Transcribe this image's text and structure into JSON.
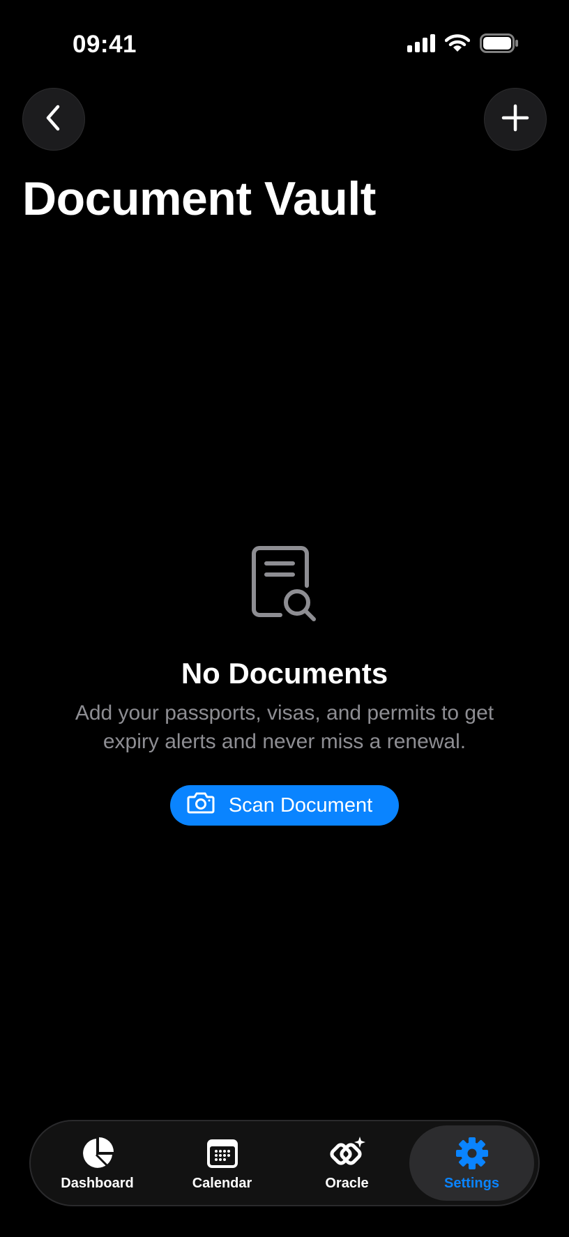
{
  "status_bar": {
    "time": "09:41"
  },
  "header": {
    "title": "Document Vault",
    "back_icon": "chevron-left-icon",
    "add_icon": "plus-icon"
  },
  "empty_state": {
    "icon": "document-search-icon",
    "title": "No Documents",
    "description": "Add your passports, visas, and permits to get expiry alerts and never miss a renewal.",
    "button_label": "Scan Document",
    "button_icon": "camera-icon"
  },
  "tab_bar": {
    "tabs": [
      {
        "label": "Dashboard",
        "icon": "pie-chart-icon",
        "active": false
      },
      {
        "label": "Calendar",
        "icon": "calendar-icon",
        "active": false
      },
      {
        "label": "Oracle",
        "icon": "sparkle-link-icon",
        "active": false
      },
      {
        "label": "Settings",
        "icon": "gear-icon",
        "active": true
      }
    ]
  },
  "colors": {
    "background": "#000000",
    "accent": "#0a84ff",
    "secondary_text": "#8e8e93",
    "button_surface": "#1c1c1e"
  }
}
